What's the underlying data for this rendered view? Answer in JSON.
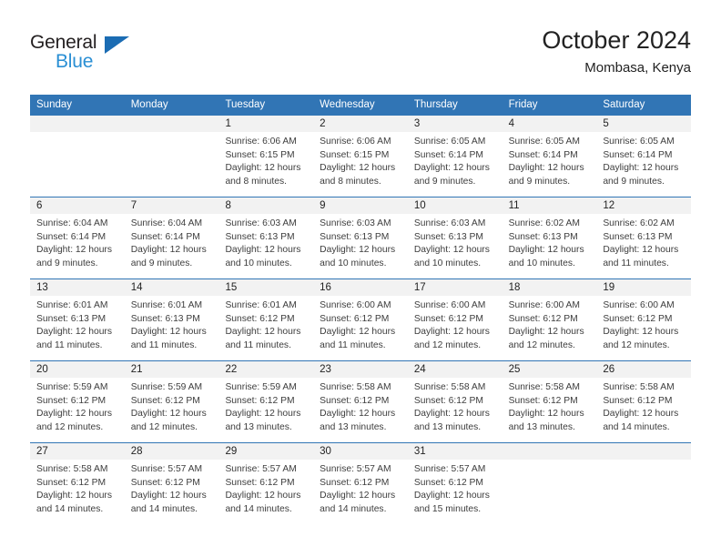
{
  "brand": {
    "name_part1": "General",
    "name_part2": "Blue",
    "triangle_icon": "triangle-icon",
    "color_dark": "#231f20",
    "color_blue": "#2a8fd4"
  },
  "header": {
    "title": "October 2024",
    "subtitle": "Mombasa, Kenya"
  },
  "theme": {
    "header_blue": "#3175b5",
    "day_band_gray": "#f2f2f2",
    "text": "#222222"
  },
  "weekdays": [
    "Sunday",
    "Monday",
    "Tuesday",
    "Wednesday",
    "Thursday",
    "Friday",
    "Saturday"
  ],
  "weeks": [
    [
      {
        "day": "",
        "sunrise": "",
        "sunset": "",
        "daylight_1": "",
        "daylight_2": "",
        "empty": true
      },
      {
        "day": "",
        "sunrise": "",
        "sunset": "",
        "daylight_1": "",
        "daylight_2": "",
        "empty": true
      },
      {
        "day": "1",
        "sunrise": "Sunrise: 6:06 AM",
        "sunset": "Sunset: 6:15 PM",
        "daylight_1": "Daylight: 12 hours",
        "daylight_2": "and 8 minutes."
      },
      {
        "day": "2",
        "sunrise": "Sunrise: 6:06 AM",
        "sunset": "Sunset: 6:15 PM",
        "daylight_1": "Daylight: 12 hours",
        "daylight_2": "and 8 minutes."
      },
      {
        "day": "3",
        "sunrise": "Sunrise: 6:05 AM",
        "sunset": "Sunset: 6:14 PM",
        "daylight_1": "Daylight: 12 hours",
        "daylight_2": "and 9 minutes."
      },
      {
        "day": "4",
        "sunrise": "Sunrise: 6:05 AM",
        "sunset": "Sunset: 6:14 PM",
        "daylight_1": "Daylight: 12 hours",
        "daylight_2": "and 9 minutes."
      },
      {
        "day": "5",
        "sunrise": "Sunrise: 6:05 AM",
        "sunset": "Sunset: 6:14 PM",
        "daylight_1": "Daylight: 12 hours",
        "daylight_2": "and 9 minutes."
      }
    ],
    [
      {
        "day": "6",
        "sunrise": "Sunrise: 6:04 AM",
        "sunset": "Sunset: 6:14 PM",
        "daylight_1": "Daylight: 12 hours",
        "daylight_2": "and 9 minutes."
      },
      {
        "day": "7",
        "sunrise": "Sunrise: 6:04 AM",
        "sunset": "Sunset: 6:14 PM",
        "daylight_1": "Daylight: 12 hours",
        "daylight_2": "and 9 minutes."
      },
      {
        "day": "8",
        "sunrise": "Sunrise: 6:03 AM",
        "sunset": "Sunset: 6:13 PM",
        "daylight_1": "Daylight: 12 hours",
        "daylight_2": "and 10 minutes."
      },
      {
        "day": "9",
        "sunrise": "Sunrise: 6:03 AM",
        "sunset": "Sunset: 6:13 PM",
        "daylight_1": "Daylight: 12 hours",
        "daylight_2": "and 10 minutes."
      },
      {
        "day": "10",
        "sunrise": "Sunrise: 6:03 AM",
        "sunset": "Sunset: 6:13 PM",
        "daylight_1": "Daylight: 12 hours",
        "daylight_2": "and 10 minutes."
      },
      {
        "day": "11",
        "sunrise": "Sunrise: 6:02 AM",
        "sunset": "Sunset: 6:13 PM",
        "daylight_1": "Daylight: 12 hours",
        "daylight_2": "and 10 minutes."
      },
      {
        "day": "12",
        "sunrise": "Sunrise: 6:02 AM",
        "sunset": "Sunset: 6:13 PM",
        "daylight_1": "Daylight: 12 hours",
        "daylight_2": "and 11 minutes."
      }
    ],
    [
      {
        "day": "13",
        "sunrise": "Sunrise: 6:01 AM",
        "sunset": "Sunset: 6:13 PM",
        "daylight_1": "Daylight: 12 hours",
        "daylight_2": "and 11 minutes."
      },
      {
        "day": "14",
        "sunrise": "Sunrise: 6:01 AM",
        "sunset": "Sunset: 6:13 PM",
        "daylight_1": "Daylight: 12 hours",
        "daylight_2": "and 11 minutes."
      },
      {
        "day": "15",
        "sunrise": "Sunrise: 6:01 AM",
        "sunset": "Sunset: 6:12 PM",
        "daylight_1": "Daylight: 12 hours",
        "daylight_2": "and 11 minutes."
      },
      {
        "day": "16",
        "sunrise": "Sunrise: 6:00 AM",
        "sunset": "Sunset: 6:12 PM",
        "daylight_1": "Daylight: 12 hours",
        "daylight_2": "and 11 minutes."
      },
      {
        "day": "17",
        "sunrise": "Sunrise: 6:00 AM",
        "sunset": "Sunset: 6:12 PM",
        "daylight_1": "Daylight: 12 hours",
        "daylight_2": "and 12 minutes."
      },
      {
        "day": "18",
        "sunrise": "Sunrise: 6:00 AM",
        "sunset": "Sunset: 6:12 PM",
        "daylight_1": "Daylight: 12 hours",
        "daylight_2": "and 12 minutes."
      },
      {
        "day": "19",
        "sunrise": "Sunrise: 6:00 AM",
        "sunset": "Sunset: 6:12 PM",
        "daylight_1": "Daylight: 12 hours",
        "daylight_2": "and 12 minutes."
      }
    ],
    [
      {
        "day": "20",
        "sunrise": "Sunrise: 5:59 AM",
        "sunset": "Sunset: 6:12 PM",
        "daylight_1": "Daylight: 12 hours",
        "daylight_2": "and 12 minutes."
      },
      {
        "day": "21",
        "sunrise": "Sunrise: 5:59 AM",
        "sunset": "Sunset: 6:12 PM",
        "daylight_1": "Daylight: 12 hours",
        "daylight_2": "and 12 minutes."
      },
      {
        "day": "22",
        "sunrise": "Sunrise: 5:59 AM",
        "sunset": "Sunset: 6:12 PM",
        "daylight_1": "Daylight: 12 hours",
        "daylight_2": "and 13 minutes."
      },
      {
        "day": "23",
        "sunrise": "Sunrise: 5:58 AM",
        "sunset": "Sunset: 6:12 PM",
        "daylight_1": "Daylight: 12 hours",
        "daylight_2": "and 13 minutes."
      },
      {
        "day": "24",
        "sunrise": "Sunrise: 5:58 AM",
        "sunset": "Sunset: 6:12 PM",
        "daylight_1": "Daylight: 12 hours",
        "daylight_2": "and 13 minutes."
      },
      {
        "day": "25",
        "sunrise": "Sunrise: 5:58 AM",
        "sunset": "Sunset: 6:12 PM",
        "daylight_1": "Daylight: 12 hours",
        "daylight_2": "and 13 minutes."
      },
      {
        "day": "26",
        "sunrise": "Sunrise: 5:58 AM",
        "sunset": "Sunset: 6:12 PM",
        "daylight_1": "Daylight: 12 hours",
        "daylight_2": "and 14 minutes."
      }
    ],
    [
      {
        "day": "27",
        "sunrise": "Sunrise: 5:58 AM",
        "sunset": "Sunset: 6:12 PM",
        "daylight_1": "Daylight: 12 hours",
        "daylight_2": "and 14 minutes."
      },
      {
        "day": "28",
        "sunrise": "Sunrise: 5:57 AM",
        "sunset": "Sunset: 6:12 PM",
        "daylight_1": "Daylight: 12 hours",
        "daylight_2": "and 14 minutes."
      },
      {
        "day": "29",
        "sunrise": "Sunrise: 5:57 AM",
        "sunset": "Sunset: 6:12 PM",
        "daylight_1": "Daylight: 12 hours",
        "daylight_2": "and 14 minutes."
      },
      {
        "day": "30",
        "sunrise": "Sunrise: 5:57 AM",
        "sunset": "Sunset: 6:12 PM",
        "daylight_1": "Daylight: 12 hours",
        "daylight_2": "and 14 minutes."
      },
      {
        "day": "31",
        "sunrise": "Sunrise: 5:57 AM",
        "sunset": "Sunset: 6:12 PM",
        "daylight_1": "Daylight: 12 hours",
        "daylight_2": "and 15 minutes."
      },
      {
        "day": "",
        "sunrise": "",
        "sunset": "",
        "daylight_1": "",
        "daylight_2": "",
        "empty": true
      },
      {
        "day": "",
        "sunrise": "",
        "sunset": "",
        "daylight_1": "",
        "daylight_2": "",
        "empty": true
      }
    ]
  ]
}
